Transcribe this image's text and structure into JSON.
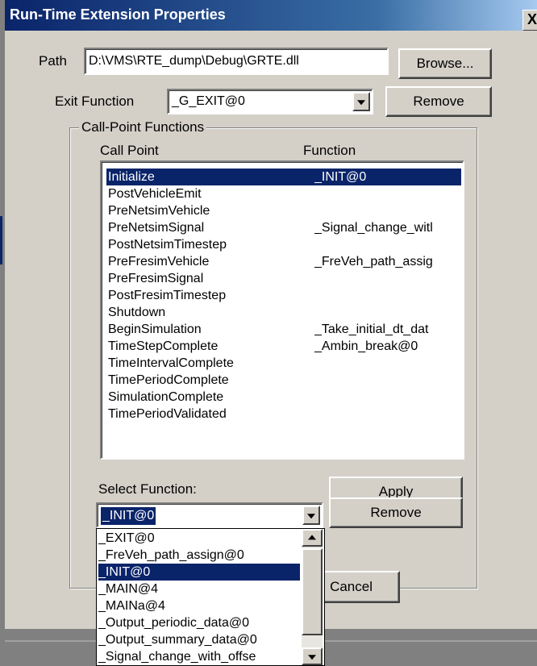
{
  "window": {
    "title": "Run-Time Extension Properties",
    "close_glyph": "X"
  },
  "path": {
    "label": "Path",
    "value": "D:\\VMS\\RTE_dump\\Debug\\GRTE.dll",
    "browse_label": "Browse..."
  },
  "exit_function": {
    "label": "Exit Function",
    "value": "_G_EXIT@0",
    "remove_label": "Remove"
  },
  "group": {
    "title": "Call-Point Functions",
    "col_call_point": "Call Point",
    "col_function": "Function",
    "rows": [
      {
        "call_point": "Initialize",
        "function": "_INIT@0"
      },
      {
        "call_point": "PostVehicleEmit",
        "function": ""
      },
      {
        "call_point": "PreNetsimVehicle",
        "function": ""
      },
      {
        "call_point": "PreNetsimSignal",
        "function": "_Signal_change_witl"
      },
      {
        "call_point": "PostNetsimTimestep",
        "function": ""
      },
      {
        "call_point": "PreFresimVehicle",
        "function": "_FreVeh_path_assig"
      },
      {
        "call_point": "PreFresimSignal",
        "function": ""
      },
      {
        "call_point": "PostFresimTimestep",
        "function": ""
      },
      {
        "call_point": "Shutdown",
        "function": ""
      },
      {
        "call_point": "BeginSimulation",
        "function": "_Take_initial_dt_dat"
      },
      {
        "call_point": "TimeStepComplete",
        "function": "_Ambin_break@0"
      },
      {
        "call_point": "TimeIntervalComplete",
        "function": ""
      },
      {
        "call_point": "TimePeriodComplete",
        "function": ""
      },
      {
        "call_point": "SimulationComplete",
        "function": ""
      },
      {
        "call_point": "TimePeriodValidated",
        "function": ""
      }
    ],
    "selected_row": 0,
    "select_function_label": "Select Function:",
    "select_function_value": "_INIT@0",
    "apply_label": "Apply",
    "remove_label": "Remove"
  },
  "dropdown": {
    "options": [
      "_EXIT@0",
      "_FreVeh_path_assign@0",
      "_INIT@0",
      "_MAIN@4",
      "_MAINa@4",
      "_Output_periodic_data@0",
      "_Output_summary_data@0",
      "_Signal_change_with_offse"
    ],
    "selected_index": 2
  },
  "footer": {
    "cancel_label": "Cancel"
  },
  "colors": {
    "selection": "#0a246a",
    "face": "#d4d0c8",
    "background": "#808080"
  }
}
